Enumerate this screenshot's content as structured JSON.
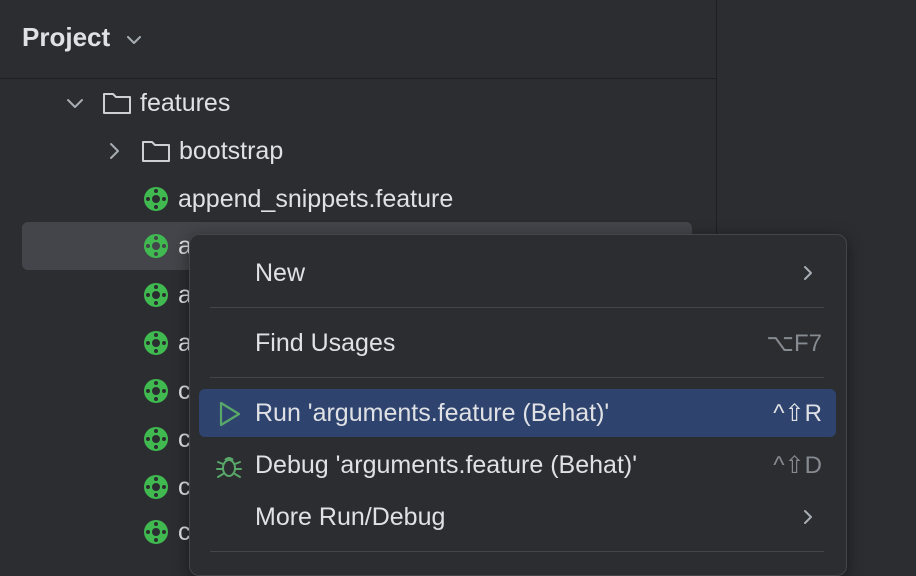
{
  "panel": {
    "title": "Project"
  },
  "tree": {
    "items": [
      {
        "label": "features"
      },
      {
        "label": "bootstrap"
      },
      {
        "label": "append_snippets.feature"
      },
      {
        "label": "a"
      },
      {
        "label": "a"
      },
      {
        "label": "a"
      },
      {
        "label": "c"
      },
      {
        "label": "c"
      },
      {
        "label": "c"
      },
      {
        "label": "c"
      }
    ]
  },
  "context_menu": {
    "new": {
      "label": "New"
    },
    "find_usages": {
      "label": "Find Usages",
      "shortcut": "⌥F7"
    },
    "run": {
      "label": "Run 'arguments.feature (Behat)'",
      "shortcut": "^⇧R"
    },
    "debug": {
      "label": "Debug 'arguments.feature (Behat)'",
      "shortcut": "^⇧D"
    },
    "more_run_debug": {
      "label": "More Run/Debug"
    }
  },
  "colors": {
    "background": "#2b2d30",
    "selection": "#43454a",
    "menu_active": "#2e436e",
    "cucumber_green": "#3fb950",
    "run_green": "#59a869"
  }
}
